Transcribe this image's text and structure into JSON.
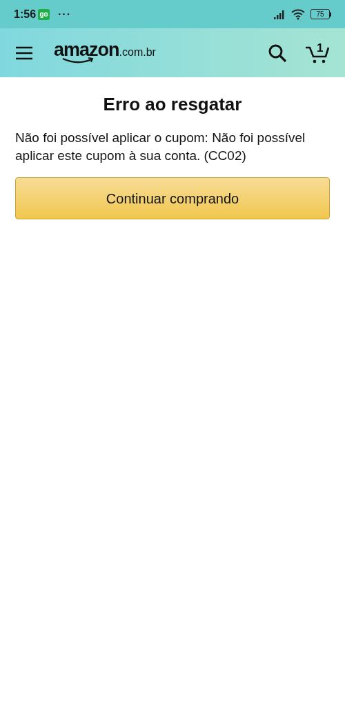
{
  "status_bar": {
    "time": "1:56",
    "app_badge": "go",
    "more": "···",
    "battery": "75"
  },
  "header": {
    "logo": "amazon",
    "logo_domain": ".com.br",
    "cart_count": "1"
  },
  "title": "Erro ao resgatar",
  "message": "Não foi possível aplicar o cupom: Não foi possível aplicar este cupom à sua conta. (CC02)",
  "button": "Continuar comprando"
}
